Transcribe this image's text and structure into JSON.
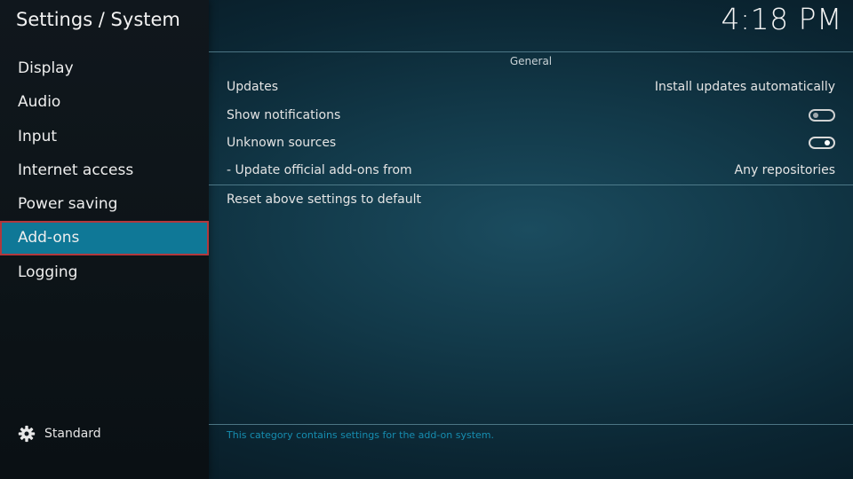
{
  "header": {
    "title": "Settings / System",
    "clock": "4:18 PM"
  },
  "sidebar": {
    "items": [
      {
        "label": "Display"
      },
      {
        "label": "Audio"
      },
      {
        "label": "Input"
      },
      {
        "label": "Internet access"
      },
      {
        "label": "Power saving"
      },
      {
        "label": "Add-ons",
        "selected": true
      },
      {
        "label": "Logging"
      }
    ],
    "settings_level": {
      "icon": "gear-icon",
      "label": "Standard"
    }
  },
  "content": {
    "group_header": "General",
    "settings": [
      {
        "label": "Updates",
        "value": "Install updates automatically"
      },
      {
        "label": "Show notifications",
        "control": "toggle",
        "enabled": false
      },
      {
        "label": "Unknown sources",
        "control": "toggle",
        "enabled": true
      },
      {
        "label": "- Update official add-ons from",
        "value": "Any repositories"
      }
    ],
    "reset_label": "Reset above settings to default",
    "description": "This category contains settings for the add-on system."
  },
  "colors": {
    "selection": "#0f7897",
    "selection_border": "#b2383d",
    "description_text": "#168db0",
    "background": "#123949"
  }
}
